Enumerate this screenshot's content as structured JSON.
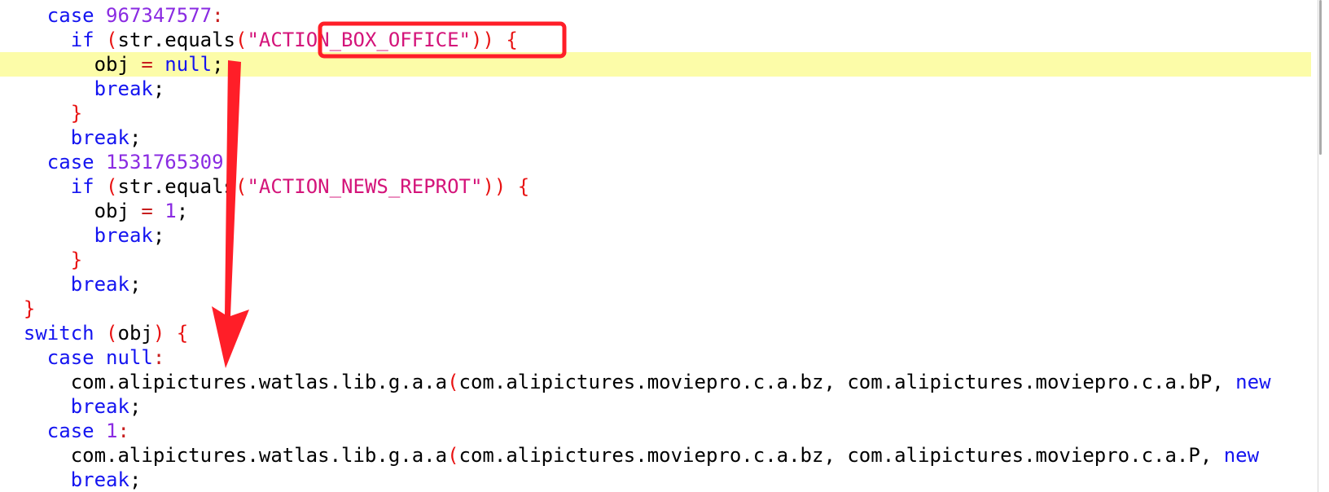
{
  "colors": {
    "keyword": "#1414f0",
    "number": "#8a2be2",
    "string": "#d4147a",
    "bracket": "#e81212",
    "identifier": "#000000",
    "highlight_line": "#fcfca8",
    "annotation": "#ff1e28"
  },
  "lines": [
    {
      "indent": 4,
      "tokens": [
        {
          "t": "case ",
          "k": "kw"
        },
        {
          "t": "967347577",
          "k": "num"
        },
        {
          "t": ":",
          "k": "op"
        }
      ]
    },
    {
      "indent": 6,
      "tokens": [
        {
          "t": "if ",
          "k": "kw"
        },
        {
          "t": "(",
          "k": "br"
        },
        {
          "t": "str.equals",
          "k": "id"
        },
        {
          "t": "(",
          "k": "br"
        },
        {
          "t": "\"ACTION_BOX_OFFICE\"",
          "k": "str"
        },
        {
          "t": ")",
          "k": "br"
        },
        {
          "t": ") {",
          "k": "br"
        }
      ]
    },
    {
      "indent": 8,
      "highlight": true,
      "tokens": [
        {
          "t": "obj ",
          "k": "id"
        },
        {
          "t": "=",
          "k": "op"
        },
        {
          "t": " ",
          "k": "id"
        },
        {
          "t": "null",
          "k": "kw"
        },
        {
          "t": ";",
          "k": "punc"
        }
      ]
    },
    {
      "indent": 8,
      "tokens": [
        {
          "t": "break",
          "k": "kw"
        },
        {
          "t": ";",
          "k": "punc"
        }
      ]
    },
    {
      "indent": 6,
      "tokens": [
        {
          "t": "}",
          "k": "br"
        }
      ]
    },
    {
      "indent": 6,
      "tokens": [
        {
          "t": "break",
          "k": "kw"
        },
        {
          "t": ";",
          "k": "punc"
        }
      ]
    },
    {
      "indent": 4,
      "tokens": [
        {
          "t": "case ",
          "k": "kw"
        },
        {
          "t": "1531765309",
          "k": "num"
        },
        {
          "t": ":",
          "k": "op"
        }
      ]
    },
    {
      "indent": 6,
      "tokens": [
        {
          "t": "if ",
          "k": "kw"
        },
        {
          "t": "(",
          "k": "br"
        },
        {
          "t": "str.equals",
          "k": "id"
        },
        {
          "t": "(",
          "k": "br"
        },
        {
          "t": "\"ACTION_NEWS_REPROT\"",
          "k": "str"
        },
        {
          "t": ")",
          "k": "br"
        },
        {
          "t": ") {",
          "k": "br"
        }
      ]
    },
    {
      "indent": 8,
      "tokens": [
        {
          "t": "obj ",
          "k": "id"
        },
        {
          "t": "=",
          "k": "op"
        },
        {
          "t": " ",
          "k": "id"
        },
        {
          "t": "1",
          "k": "num"
        },
        {
          "t": ";",
          "k": "punc"
        }
      ]
    },
    {
      "indent": 8,
      "tokens": [
        {
          "t": "break",
          "k": "kw"
        },
        {
          "t": ";",
          "k": "punc"
        }
      ]
    },
    {
      "indent": 6,
      "tokens": [
        {
          "t": "}",
          "k": "br"
        }
      ]
    },
    {
      "indent": 6,
      "tokens": [
        {
          "t": "break",
          "k": "kw"
        },
        {
          "t": ";",
          "k": "punc"
        }
      ]
    },
    {
      "indent": 2,
      "tokens": [
        {
          "t": "}",
          "k": "br"
        }
      ]
    },
    {
      "indent": 2,
      "tokens": [
        {
          "t": "switch ",
          "k": "kw"
        },
        {
          "t": "(",
          "k": "br"
        },
        {
          "t": "obj",
          "k": "id"
        },
        {
          "t": ")",
          "k": "br"
        },
        {
          "t": " {",
          "k": "br"
        }
      ]
    },
    {
      "indent": 4,
      "tokens": [
        {
          "t": "case ",
          "k": "kw"
        },
        {
          "t": "null",
          "k": "kw"
        },
        {
          "t": ":",
          "k": "op"
        }
      ]
    },
    {
      "indent": 6,
      "tokens": [
        {
          "t": "com.alipictures.watlas.lib.g.a.a",
          "k": "id"
        },
        {
          "t": "(",
          "k": "br"
        },
        {
          "t": "com.alipictures.moviepro.c.a.bz, com.alipictures.moviepro.c.a.bP, ",
          "k": "id"
        },
        {
          "t": "new",
          "k": "kw"
        }
      ]
    },
    {
      "indent": 6,
      "tokens": [
        {
          "t": "break",
          "k": "kw"
        },
        {
          "t": ";",
          "k": "punc"
        }
      ]
    },
    {
      "indent": 4,
      "tokens": [
        {
          "t": "case ",
          "k": "kw"
        },
        {
          "t": "1",
          "k": "num"
        },
        {
          "t": ":",
          "k": "op"
        }
      ]
    },
    {
      "indent": 6,
      "tokens": [
        {
          "t": "com.alipictures.watlas.lib.g.a.a",
          "k": "id"
        },
        {
          "t": "(",
          "k": "br"
        },
        {
          "t": "com.alipictures.moviepro.c.a.bz, com.alipictures.moviepro.c.a.P, ",
          "k": "id"
        },
        {
          "t": "new",
          "k": "kw"
        }
      ]
    },
    {
      "indent": 6,
      "tokens": [
        {
          "t": "break",
          "k": "kw"
        },
        {
          "t": ";",
          "k": "punc"
        }
      ]
    }
  ]
}
